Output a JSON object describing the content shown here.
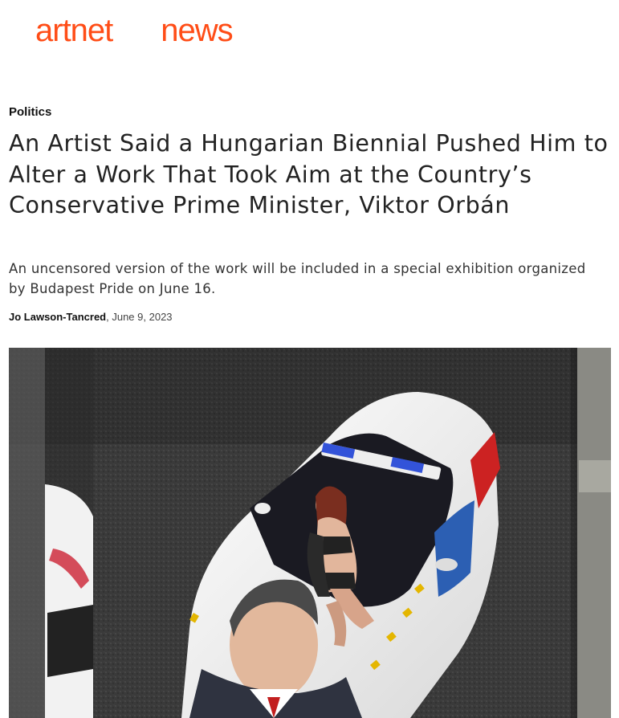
{
  "site": {
    "logo_left": "artnet",
    "logo_right": "news",
    "brand_color": "#ff4d17"
  },
  "article": {
    "category": "Politics",
    "headline": "An Artist Said a Hungarian Biennial Pushed Him to Alter a Work That Took Aim at the Country’s Conservative Prime Minister, Viktor Orbán",
    "dek": "An uncensored version of the work will be included in a special exhibition organized by Budapest Pride on June 16.",
    "author": "Jo Lawson-Tancred",
    "date": ", June 9, 2023"
  }
}
